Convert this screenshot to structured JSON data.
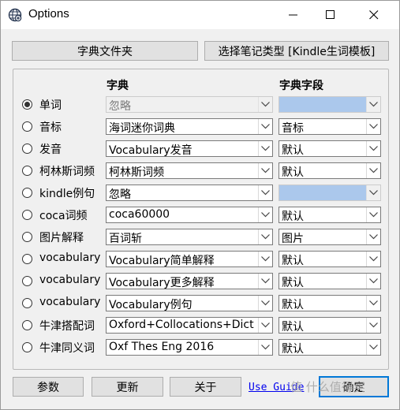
{
  "window": {
    "title": "Options"
  },
  "buttons": {
    "folder": "字典文件夹",
    "note_type": "选择笔记类型 [Kindle生词模板]",
    "params": "参数",
    "update": "更新",
    "about": "关于",
    "ok": "确定"
  },
  "headers": {
    "dict": "字典",
    "field": "字典字段"
  },
  "rows": [
    {
      "label": "单词",
      "selected": true,
      "dict": "忽略",
      "dict_disabled": true,
      "field": "",
      "field_disabled": true
    },
    {
      "label": "音标",
      "selected": false,
      "dict": "海词迷你词典",
      "dict_disabled": false,
      "field": "音标",
      "field_disabled": false
    },
    {
      "label": "发音",
      "selected": false,
      "dict": "Vocabulary发音",
      "dict_disabled": false,
      "field": "默认",
      "field_disabled": false
    },
    {
      "label": "柯林斯词频",
      "selected": false,
      "dict": "柯林斯词频",
      "dict_disabled": false,
      "field": "默认",
      "field_disabled": false
    },
    {
      "label": "kindle例句",
      "selected": false,
      "dict": "忽略",
      "dict_disabled": false,
      "field": "",
      "field_disabled": true
    },
    {
      "label": "coca词频",
      "selected": false,
      "dict": "coca60000",
      "dict_disabled": false,
      "field": "默认",
      "field_disabled": false
    },
    {
      "label": "图片解释",
      "selected": false,
      "dict": "百词斩",
      "dict_disabled": false,
      "field": "图片",
      "field_disabled": false
    },
    {
      "label": "vocabulary",
      "selected": false,
      "dict": "Vocabulary简单解释",
      "dict_disabled": false,
      "field": "默认",
      "field_disabled": false
    },
    {
      "label": "vocabulary",
      "selected": false,
      "dict": "Vocabulary更多解释",
      "dict_disabled": false,
      "field": "默认",
      "field_disabled": false
    },
    {
      "label": "vocabulary",
      "selected": false,
      "dict": "Vocabulary例句",
      "dict_disabled": false,
      "field": "默认",
      "field_disabled": false
    },
    {
      "label": "牛津搭配词",
      "selected": false,
      "dict": "Oxford+Collocations+Dict",
      "dict_disabled": false,
      "field": "默认",
      "field_disabled": false
    },
    {
      "label": "牛津同义词",
      "selected": false,
      "dict": "Oxf Thes Eng 2016",
      "dict_disabled": false,
      "field": "默认",
      "field_disabled": false
    }
  ],
  "footer": {
    "link": "Use Guide"
  },
  "watermark": "值 什么值得买",
  "icons": {
    "app": "globe-icon",
    "minimize": "minimize-icon",
    "maximize": "maximize-icon",
    "close": "close-icon",
    "dropdown": "chevron-down-icon"
  }
}
